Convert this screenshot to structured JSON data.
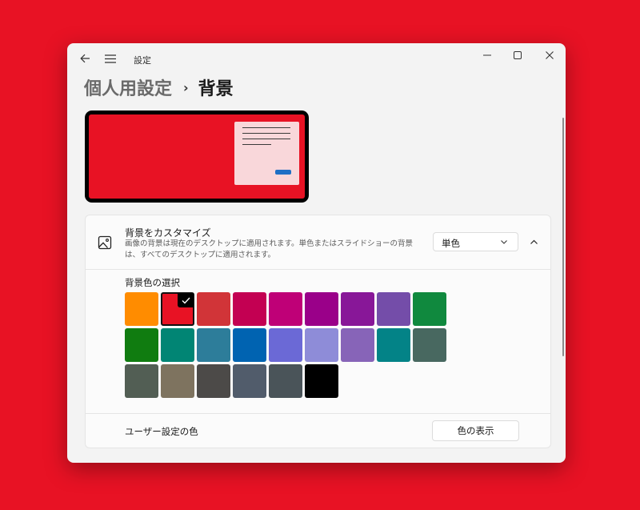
{
  "window": {
    "app_title": "設定"
  },
  "breadcrumb": {
    "parent": "個人用設定",
    "separator": "›",
    "current": "背景"
  },
  "customize": {
    "title": "背景をカスタマイズ",
    "description": "画像の背景は現在のデスクトップに適用されます。単色またはスライドショーの背景は、すべてのデスクトップに適用されます。",
    "dropdown_value": "単色"
  },
  "colors": {
    "label": "背景色の選択",
    "selected": "#E81224",
    "swatches": [
      "#FF8C00",
      "#E81224",
      "#D13438",
      "#C30052",
      "#BF0077",
      "#9A0089",
      "#881798",
      "#744DA9",
      "#10893E",
      "#107C10",
      "#018574",
      "#2D7D9A",
      "#0063B1",
      "#6B69D6",
      "#8E8CD8",
      "#8764B8",
      "#038387",
      "#486860",
      "#525E54",
      "#7E735F",
      "#4C4A48",
      "#515C6B",
      "#4A5459",
      "#000000"
    ]
  },
  "custom": {
    "label": "ユーザー設定の色",
    "button_label": "色の表示"
  }
}
